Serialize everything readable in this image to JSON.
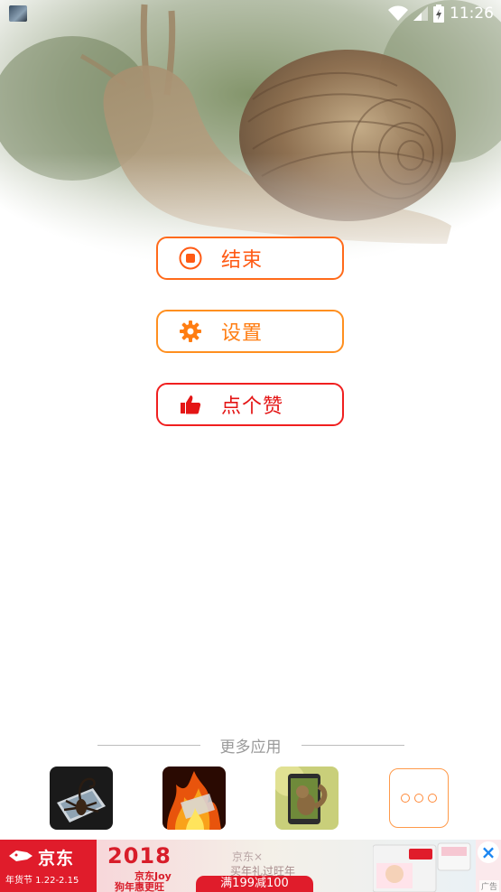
{
  "status_bar": {
    "time": "11:26"
  },
  "buttons": {
    "end": {
      "label": "结束",
      "color": "#ff5a14"
    },
    "settings": {
      "label": "设置",
      "color": "#ff7d12"
    },
    "like": {
      "label": "点个赞",
      "color": "#e41515"
    }
  },
  "more_apps": {
    "title": "更多应用",
    "items": [
      {
        "icon": "scorpion-phone-app-icon"
      },
      {
        "icon": "fire-phone-app-icon"
      },
      {
        "icon": "squirrel-phone-app-icon"
      },
      {
        "icon": "more-dots-icon"
      }
    ]
  },
  "ad": {
    "brand": "京东",
    "date_line": "年货节 1.22-2.15",
    "year": "2018",
    "joy": "京东Joy",
    "slogan": "狗年惠更旺",
    "partner": "京东×",
    "subtitle": "买年礼过旺年",
    "price": "满199减100",
    "mark": "广告"
  }
}
